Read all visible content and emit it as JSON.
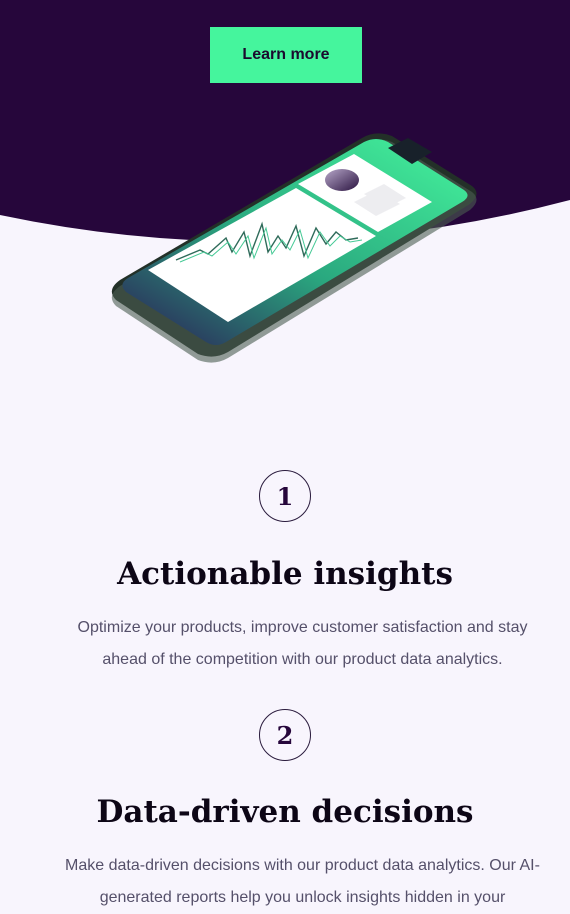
{
  "hero": {
    "cta_label": "Learn more",
    "colors": {
      "background": "#26063b",
      "cta": "#45f59d",
      "accent": "#3de38e"
    },
    "illustration": "phone-analytics-illustration"
  },
  "features": [
    {
      "number": "1",
      "title": "Actionable insights",
      "description": "Optimize your products, improve customer satisfaction and stay ahead of the competition with our product data analytics."
    },
    {
      "number": "2",
      "title": "Data-driven decisions",
      "description": "Make data-driven decisions with our product data analytics. Our AI-generated reports help you unlock insights hidden in your"
    }
  ]
}
